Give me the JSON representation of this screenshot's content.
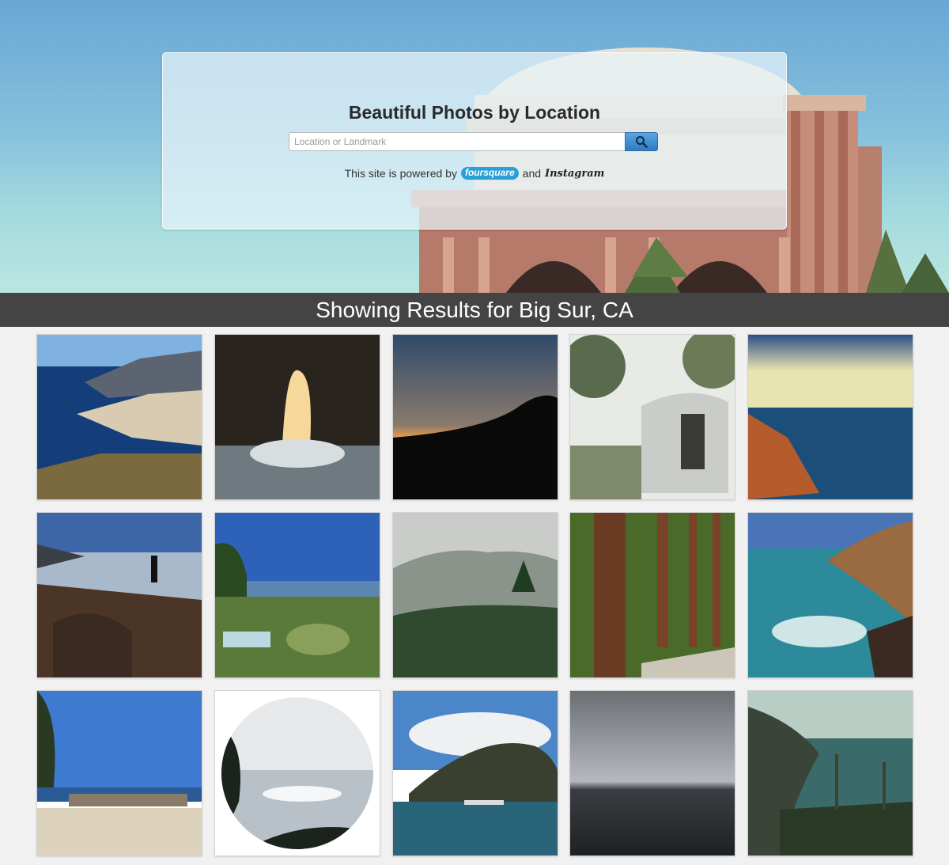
{
  "header": {
    "title": "Beautiful Photos by Location",
    "search_placeholder": "Location or Landmark",
    "powered_prefix": "This site is powered by",
    "powered_and": "and",
    "foursquare_label": "foursquare",
    "instagram_label": "Instagram"
  },
  "results": {
    "banner_text": "Showing Results for Big Sur, CA"
  },
  "photos": [
    {
      "icon": "coastline-cliffs-photo"
    },
    {
      "icon": "sea-cave-arch-photo"
    },
    {
      "icon": "sunset-silhouette-photo"
    },
    {
      "icon": "vintage-trailer-photo"
    },
    {
      "icon": "coastal-vista-photo"
    },
    {
      "icon": "person-on-cliff-photo"
    },
    {
      "icon": "garden-ocean-view-photo"
    },
    {
      "icon": "misty-forest-photo"
    },
    {
      "icon": "redwood-forest-photo"
    },
    {
      "icon": "rocky-cove-photo"
    },
    {
      "icon": "mailboxes-roadside-photo"
    },
    {
      "icon": "circular-ocean-photo"
    },
    {
      "icon": "bixby-bridge-photo"
    },
    {
      "icon": "grey-ocean-horizon-photo"
    },
    {
      "icon": "foggy-coastline-photo"
    }
  ],
  "colors": {
    "banner_bg": "#444444",
    "search_button": "#3a86c9",
    "foursquare_blue": "#2a9fd8"
  }
}
